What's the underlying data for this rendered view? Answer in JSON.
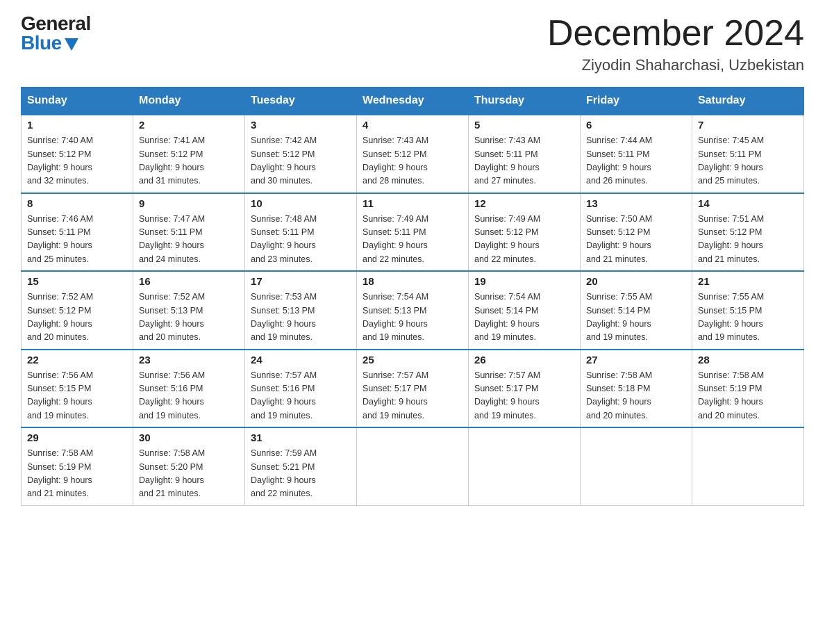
{
  "header": {
    "logo_general": "General",
    "logo_blue": "Blue",
    "month_title": "December 2024",
    "location": "Ziyodin Shaharchasi, Uzbekistan"
  },
  "weekdays": [
    "Sunday",
    "Monday",
    "Tuesday",
    "Wednesday",
    "Thursday",
    "Friday",
    "Saturday"
  ],
  "weeks": [
    [
      {
        "day": "1",
        "sunrise": "7:40 AM",
        "sunset": "5:12 PM",
        "daylight": "9 hours and 32 minutes."
      },
      {
        "day": "2",
        "sunrise": "7:41 AM",
        "sunset": "5:12 PM",
        "daylight": "9 hours and 31 minutes."
      },
      {
        "day": "3",
        "sunrise": "7:42 AM",
        "sunset": "5:12 PM",
        "daylight": "9 hours and 30 minutes."
      },
      {
        "day": "4",
        "sunrise": "7:43 AM",
        "sunset": "5:12 PM",
        "daylight": "9 hours and 28 minutes."
      },
      {
        "day": "5",
        "sunrise": "7:43 AM",
        "sunset": "5:11 PM",
        "daylight": "9 hours and 27 minutes."
      },
      {
        "day": "6",
        "sunrise": "7:44 AM",
        "sunset": "5:11 PM",
        "daylight": "9 hours and 26 minutes."
      },
      {
        "day": "7",
        "sunrise": "7:45 AM",
        "sunset": "5:11 PM",
        "daylight": "9 hours and 25 minutes."
      }
    ],
    [
      {
        "day": "8",
        "sunrise": "7:46 AM",
        "sunset": "5:11 PM",
        "daylight": "9 hours and 25 minutes."
      },
      {
        "day": "9",
        "sunrise": "7:47 AM",
        "sunset": "5:11 PM",
        "daylight": "9 hours and 24 minutes."
      },
      {
        "day": "10",
        "sunrise": "7:48 AM",
        "sunset": "5:11 PM",
        "daylight": "9 hours and 23 minutes."
      },
      {
        "day": "11",
        "sunrise": "7:49 AM",
        "sunset": "5:11 PM",
        "daylight": "9 hours and 22 minutes."
      },
      {
        "day": "12",
        "sunrise": "7:49 AM",
        "sunset": "5:12 PM",
        "daylight": "9 hours and 22 minutes."
      },
      {
        "day": "13",
        "sunrise": "7:50 AM",
        "sunset": "5:12 PM",
        "daylight": "9 hours and 21 minutes."
      },
      {
        "day": "14",
        "sunrise": "7:51 AM",
        "sunset": "5:12 PM",
        "daylight": "9 hours and 21 minutes."
      }
    ],
    [
      {
        "day": "15",
        "sunrise": "7:52 AM",
        "sunset": "5:12 PM",
        "daylight": "9 hours and 20 minutes."
      },
      {
        "day": "16",
        "sunrise": "7:52 AM",
        "sunset": "5:13 PM",
        "daylight": "9 hours and 20 minutes."
      },
      {
        "day": "17",
        "sunrise": "7:53 AM",
        "sunset": "5:13 PM",
        "daylight": "9 hours and 19 minutes."
      },
      {
        "day": "18",
        "sunrise": "7:54 AM",
        "sunset": "5:13 PM",
        "daylight": "9 hours and 19 minutes."
      },
      {
        "day": "19",
        "sunrise": "7:54 AM",
        "sunset": "5:14 PM",
        "daylight": "9 hours and 19 minutes."
      },
      {
        "day": "20",
        "sunrise": "7:55 AM",
        "sunset": "5:14 PM",
        "daylight": "9 hours and 19 minutes."
      },
      {
        "day": "21",
        "sunrise": "7:55 AM",
        "sunset": "5:15 PM",
        "daylight": "9 hours and 19 minutes."
      }
    ],
    [
      {
        "day": "22",
        "sunrise": "7:56 AM",
        "sunset": "5:15 PM",
        "daylight": "9 hours and 19 minutes."
      },
      {
        "day": "23",
        "sunrise": "7:56 AM",
        "sunset": "5:16 PM",
        "daylight": "9 hours and 19 minutes."
      },
      {
        "day": "24",
        "sunrise": "7:57 AM",
        "sunset": "5:16 PM",
        "daylight": "9 hours and 19 minutes."
      },
      {
        "day": "25",
        "sunrise": "7:57 AM",
        "sunset": "5:17 PM",
        "daylight": "9 hours and 19 minutes."
      },
      {
        "day": "26",
        "sunrise": "7:57 AM",
        "sunset": "5:17 PM",
        "daylight": "9 hours and 19 minutes."
      },
      {
        "day": "27",
        "sunrise": "7:58 AM",
        "sunset": "5:18 PM",
        "daylight": "9 hours and 20 minutes."
      },
      {
        "day": "28",
        "sunrise": "7:58 AM",
        "sunset": "5:19 PM",
        "daylight": "9 hours and 20 minutes."
      }
    ],
    [
      {
        "day": "29",
        "sunrise": "7:58 AM",
        "sunset": "5:19 PM",
        "daylight": "9 hours and 21 minutes."
      },
      {
        "day": "30",
        "sunrise": "7:58 AM",
        "sunset": "5:20 PM",
        "daylight": "9 hours and 21 minutes."
      },
      {
        "day": "31",
        "sunrise": "7:59 AM",
        "sunset": "5:21 PM",
        "daylight": "9 hours and 22 minutes."
      },
      null,
      null,
      null,
      null
    ]
  ],
  "labels": {
    "sunrise": "Sunrise:",
    "sunset": "Sunset:",
    "daylight": "Daylight:"
  }
}
